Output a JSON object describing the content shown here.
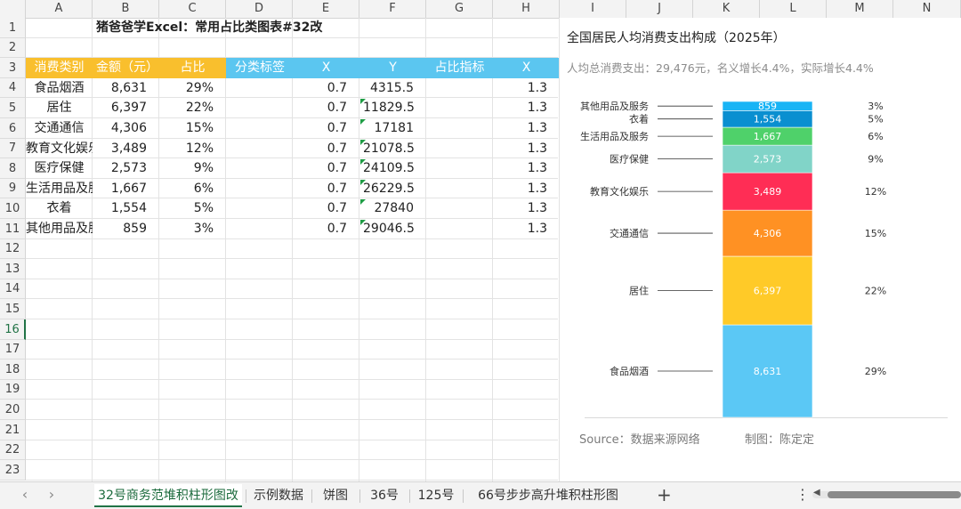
{
  "columns": [
    "A",
    "B",
    "C",
    "D",
    "E",
    "F",
    "G",
    "H",
    "I",
    "J",
    "K",
    "L",
    "M",
    "N"
  ],
  "rows": [
    "1",
    "2",
    "3",
    "4",
    "5",
    "6",
    "7",
    "8",
    "9",
    "10",
    "11",
    "12",
    "13",
    "14",
    "15",
    "16",
    "17",
    "18",
    "19",
    "20",
    "21",
    "22",
    "23"
  ],
  "sheet_title": "猪爸爸学Excel：常用占比类图表#32改",
  "table": {
    "headers": [
      "消费类别",
      "金额（元）",
      "占比",
      "分类标签",
      "X",
      "Y",
      "占比指标",
      "X"
    ],
    "rows": [
      {
        "cat": "食品烟酒",
        "amount": "8,631",
        "pct": "29%",
        "x": "0.7",
        "y": "4315.5",
        "x2": "1.3"
      },
      {
        "cat": "居住",
        "amount": "6,397",
        "pct": "22%",
        "x": "0.7",
        "y": "11829.5",
        "x2": "1.3"
      },
      {
        "cat": "交通通信",
        "amount": "4,306",
        "pct": "15%",
        "x": "0.7",
        "y": "17181",
        "x2": "1.3"
      },
      {
        "cat": "教育文化娱乐",
        "amount": "3,489",
        "pct": "12%",
        "x": "0.7",
        "y": "21078.5",
        "x2": "1.3"
      },
      {
        "cat": "医疗保健",
        "amount": "2,573",
        "pct": "9%",
        "x": "0.7",
        "y": "24109.5",
        "x2": "1.3"
      },
      {
        "cat": "生活用品及服务",
        "amount": "1,667",
        "pct": "6%",
        "x": "0.7",
        "y": "26229.5",
        "x2": "1.3"
      },
      {
        "cat": "衣着",
        "amount": "1,554",
        "pct": "5%",
        "x": "0.7",
        "y": "27840",
        "x2": "1.3"
      },
      {
        "cat": "其他用品及服务",
        "amount": "859",
        "pct": "3%",
        "x": "0.7",
        "y": "29046.5",
        "x2": "1.3"
      }
    ]
  },
  "chart": {
    "title": "全国居民人均消费支出构成（2025年）",
    "subtitle": "人均总消费支出：29,476元，名义增长4.4%，实际增长4.4%",
    "source": "Source：数据来源网络",
    "maker": "制图：陈定定"
  },
  "chart_data": {
    "type": "bar",
    "stacked": true,
    "title": "全国居民人均消费支出构成（2025年）",
    "subtitle": "人均总消费支出：29,476元，名义增长4.4%，实际增长4.4%",
    "total": 29476,
    "series": [
      {
        "name": "食品烟酒",
        "value": 8631,
        "label": "8,631",
        "pct": "29%",
        "color": "#5bc8f5"
      },
      {
        "name": "居住",
        "value": 6397,
        "label": "6,397",
        "pct": "22%",
        "color": "#ffca28"
      },
      {
        "name": "交通通信",
        "value": 4306,
        "label": "4,306",
        "pct": "15%",
        "color": "#ff9123"
      },
      {
        "name": "教育文化娱乐",
        "value": 3489,
        "label": "3,489",
        "pct": "12%",
        "color": "#ff2d55"
      },
      {
        "name": "医疗保健",
        "value": 2573,
        "label": "2,573",
        "pct": "9%",
        "color": "#81d4c8"
      },
      {
        "name": "生活用品及服务",
        "value": 1667,
        "label": "1,667",
        "pct": "6%",
        "color": "#4fd16a"
      },
      {
        "name": "衣着",
        "value": 1554,
        "label": "1,554",
        "pct": "5%",
        "color": "#0a8fd0"
      },
      {
        "name": "其他用品及服务",
        "value": 859,
        "label": "859",
        "pct": "3%",
        "color": "#19b4f5"
      }
    ]
  },
  "sheet_tabs": [
    "32号商务范堆积柱形图改",
    "示例数据",
    "饼图",
    "36号",
    "125号",
    "66号步步高升堆积柱形图"
  ],
  "active_tab": "32号商务范堆积柱形图改",
  "active_row": "16",
  "colors": {
    "orange_header": "#f9bf2d",
    "blue_header": "#5bc6f0",
    "excel_green": "#217346"
  },
  "icons": {
    "prev": "chevron-left-icon",
    "next": "chevron-right-icon",
    "add": "plus-icon",
    "more": "more-vertical-icon"
  },
  "glyphs": {
    "prev": "‹",
    "next": "›",
    "add": "+",
    "more": "⋮",
    "scroll_left": "◀"
  }
}
